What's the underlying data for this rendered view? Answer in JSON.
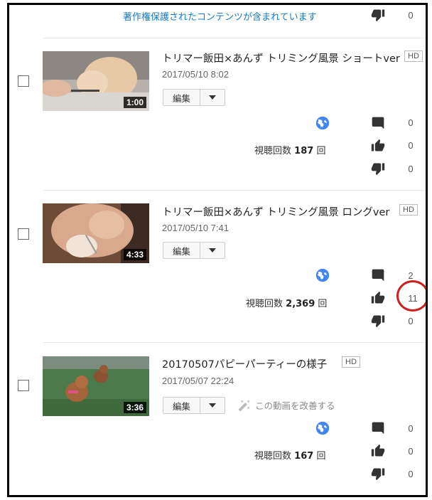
{
  "top": {
    "notice": "著作権保護されたコンテンツが含まれています",
    "dislikes": "0"
  },
  "videos": [
    {
      "title": "トリマー飯田×あんず トリミング風景 ショートver",
      "hd": "HD",
      "date": "2017/05/10 8:02",
      "duration": "1:00",
      "edit_label": "編集",
      "views_label": "視聴回数",
      "views_count": "187",
      "views_unit": "回",
      "comments": "0",
      "likes": "0",
      "dislikes": "0"
    },
    {
      "title": "トリマー飯田×あんず トリミング風景 ロングver",
      "hd": "HD",
      "date": "2017/05/10 7:41",
      "duration": "4:33",
      "edit_label": "編集",
      "views_label": "視聴回数",
      "views_count": "2,369",
      "views_unit": "回",
      "comments": "2",
      "likes": "11",
      "dislikes": "0"
    },
    {
      "title": "20170507パピーパーティーの様子",
      "hd": "HD",
      "date": "2017/05/07 22:24",
      "duration": "3:36",
      "edit_label": "編集",
      "improve_label": "この動画を改善する",
      "views_label": "視聴回数",
      "views_count": "167",
      "views_unit": "回",
      "comments": "0",
      "likes": "0",
      "dislikes": "0"
    }
  ],
  "colors": {
    "accent_link": "#167ac6",
    "globe": "#4285f4",
    "highlight_circle": "#cc1f1f"
  },
  "icons": [
    "globe-icon",
    "comment-icon",
    "thumbs-up-icon",
    "thumbs-down-icon",
    "magic-wand-icon",
    "chevron-down-icon"
  ]
}
